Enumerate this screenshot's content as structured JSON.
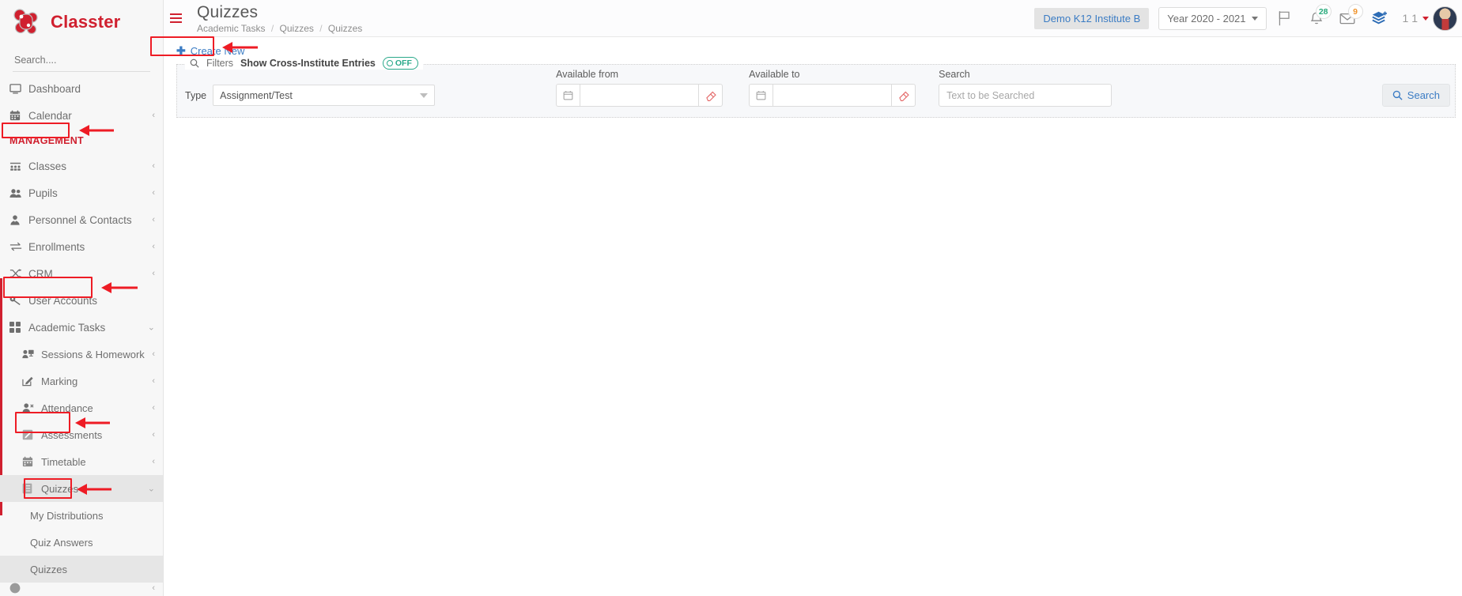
{
  "brand": {
    "name": "Classter",
    "logo_icon": "classter-logo-icon"
  },
  "sidebar": {
    "search_placeholder": "Search....",
    "top_items": [
      {
        "label": "Dashboard",
        "icon": "monitor-icon",
        "caret": false
      },
      {
        "label": "Calendar",
        "icon": "calendar-icon",
        "caret": true
      }
    ],
    "section_label": "MANAGEMENT",
    "management_items": [
      {
        "label": "Classes",
        "icon": "classes-icon",
        "caret": true
      },
      {
        "label": "Pupils",
        "icon": "users-icon",
        "caret": true
      },
      {
        "label": "Personnel & Contacts",
        "icon": "person-tie-icon",
        "caret": true
      },
      {
        "label": "Enrollments",
        "icon": "exchange-arrows-icon",
        "caret": true
      },
      {
        "label": "CRM",
        "icon": "shuffle-icon",
        "caret": true
      },
      {
        "label": "User Accounts",
        "icon": "key-icon",
        "caret": false
      },
      {
        "label": "Academic Tasks",
        "icon": "grid-squares-icon",
        "caret": true,
        "expanded": true
      }
    ],
    "academic_tasks_children": [
      {
        "label": "Sessions & Homework",
        "icon": "presentation-icon",
        "caret": true
      },
      {
        "label": "Marking",
        "icon": "pencil-square-icon",
        "caret": true
      },
      {
        "label": "Attendance",
        "icon": "person-check-icon",
        "caret": true
      },
      {
        "label": "Assessments",
        "icon": "pencil-box-icon",
        "caret": true
      },
      {
        "label": "Timetable",
        "icon": "calendar-alt-icon",
        "caret": true
      },
      {
        "label": "Quizzes",
        "icon": "list-checklist-icon",
        "caret": true,
        "expanded": true,
        "active": true
      }
    ],
    "quizzes_children": [
      {
        "label": "My Distributions",
        "active": false
      },
      {
        "label": "Quiz Answers",
        "active": false
      },
      {
        "label": "Quizzes",
        "active": true
      }
    ]
  },
  "topbar": {
    "menu_icon": "hamburger-menu-icon",
    "page_title": "Quizzes",
    "breadcrumb": [
      "Academic Tasks",
      "Quizzes",
      "Quizzes"
    ],
    "breadcrumb_separator": "/",
    "institute": "Demo K12 Institute B",
    "year": "Year 2020 - 2021",
    "icons": [
      {
        "name": "flag-icon",
        "badge": null
      },
      {
        "name": "bell-notification-icon",
        "badge": "28",
        "badge_color": "#27a97b"
      },
      {
        "name": "envelope-mail-icon",
        "badge": "9",
        "badge_color": "#f0932b"
      },
      {
        "name": "add-layer-icon",
        "badge": null
      }
    ],
    "user_count": "1 1",
    "avatar_icon": "user-avatar"
  },
  "toolbar": {
    "create_new_label": "Create New",
    "create_new_icon": "plus-icon"
  },
  "filters": {
    "legend_icon": "search-icon",
    "legend_label": "Filters",
    "cross_institute_label": "Show Cross-Institute Entries",
    "cross_institute_toggle": "OFF",
    "type_label": "Type",
    "type_value": "Assignment/Test",
    "available_from_label": "Available from",
    "available_from_value": "",
    "available_to_label": "Available to",
    "available_to_value": "",
    "search_label": "Search",
    "search_placeholder": "Text to be Searched",
    "calendar_icon": "calendar-small-icon",
    "clear_icon": "eraser-icon",
    "search_button_label": "Search",
    "search_button_icon": "search-icon"
  },
  "colors": {
    "brand_red": "#d0202f",
    "annotation_red": "#ee1c25",
    "link_blue": "#3b7cc4",
    "toggle_green": "#2aa98a",
    "badge_orange": "#f0932b"
  }
}
